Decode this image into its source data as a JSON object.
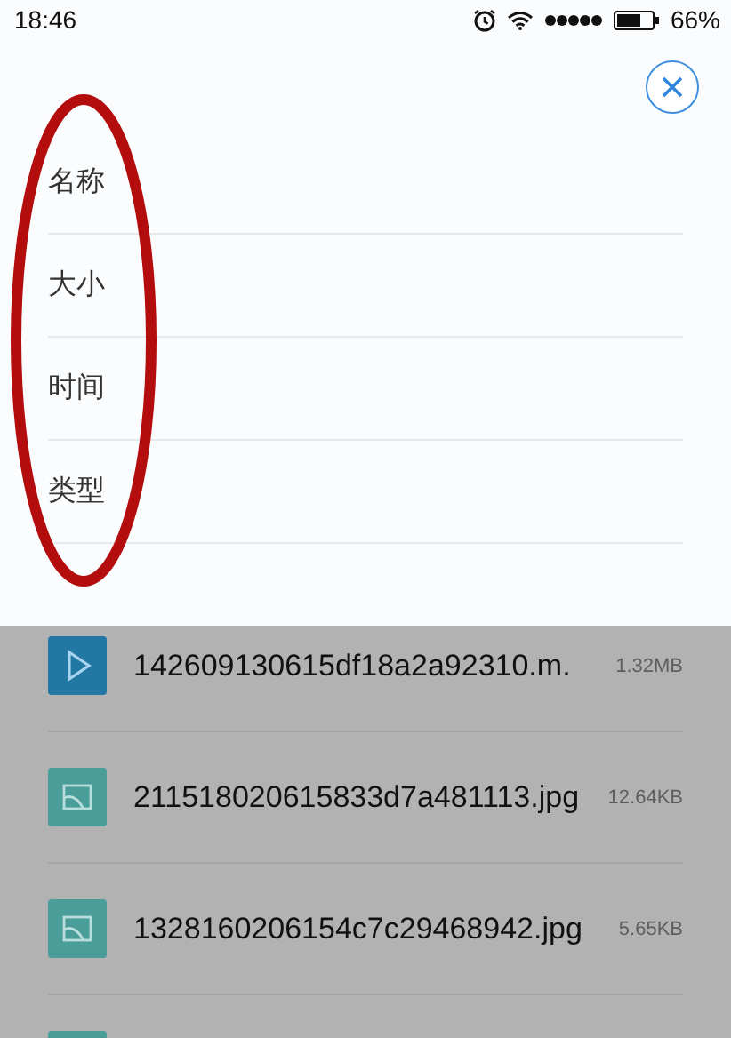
{
  "status_bar": {
    "time": "18:46",
    "battery": "66%"
  },
  "sort_menu": {
    "items": [
      {
        "label": "名称"
      },
      {
        "label": "大小"
      },
      {
        "label": "时间"
      },
      {
        "label": "类型"
      }
    ]
  },
  "files": [
    {
      "kind": "video",
      "name": "142609130615df18a2a92310.m.",
      "size": "1.32MB"
    },
    {
      "kind": "image",
      "name": "211518020615833d7a481113.jpg",
      "size": "12.64KB"
    },
    {
      "kind": "image",
      "name": "1328160206154c7c29468942.jpg",
      "size": "5.65KB"
    },
    {
      "kind": "image"
    }
  ]
}
